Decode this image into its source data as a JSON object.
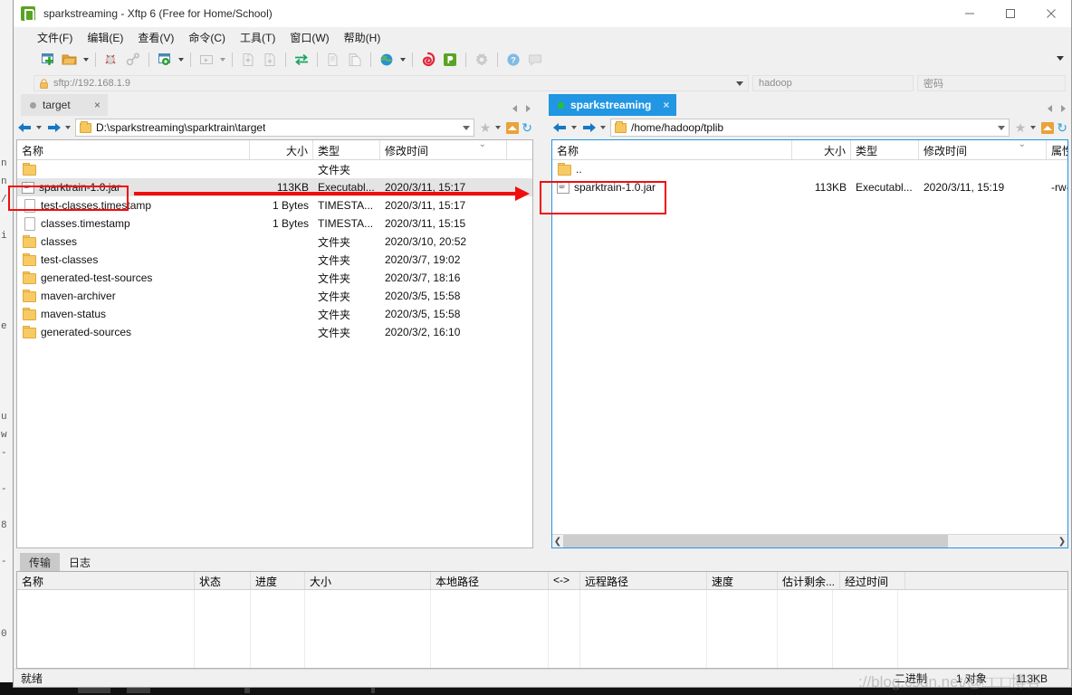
{
  "window": {
    "title": "sparkstreaming - Xftp 6 (Free for Home/School)",
    "app_icon": "xftp-icon",
    "controls": {
      "minimize": "minimize-icon",
      "maximize": "maximize-icon",
      "close": "close-icon"
    }
  },
  "menubar": [
    {
      "label": "文件(F)",
      "name": "menu-file"
    },
    {
      "label": "编辑(E)",
      "name": "menu-edit"
    },
    {
      "label": "查看(V)",
      "name": "menu-view"
    },
    {
      "label": "命令(C)",
      "name": "menu-command"
    },
    {
      "label": "工具(T)",
      "name": "menu-tools"
    },
    {
      "label": "窗口(W)",
      "name": "menu-window"
    },
    {
      "label": "帮助(H)",
      "name": "menu-help"
    }
  ],
  "connection": {
    "host": "sftp://192.168.1.9",
    "lock_icon": "lock-icon",
    "user_value": "hadoop",
    "password_placeholder": "密码"
  },
  "left_pane": {
    "tab": {
      "label": "target",
      "status_dot": "grey",
      "close": "×"
    },
    "path": "D:\\sparkstreaming\\sparktrain\\target",
    "columns": [
      "名称",
      "大小",
      "类型",
      "修改时间"
    ],
    "sort_column": "修改时间",
    "sort_direction": "desc",
    "rows": [
      {
        "icon": "folder",
        "name": "",
        "size": "",
        "type": "文件夹",
        "modified": "",
        "selected": false
      },
      {
        "icon": "jar",
        "name": "sparktrain-1.0.jar",
        "size": "113KB",
        "type": "Executabl...",
        "modified": "2020/3/11, 15:17",
        "selected": true
      },
      {
        "icon": "file",
        "name": "test-classes.timestamp",
        "size": "1 Bytes",
        "type": "TIMESTA...",
        "modified": "2020/3/11, 15:17",
        "selected": false
      },
      {
        "icon": "file",
        "name": "classes.timestamp",
        "size": "1 Bytes",
        "type": "TIMESTA...",
        "modified": "2020/3/11, 15:15",
        "selected": false
      },
      {
        "icon": "folder",
        "name": "classes",
        "size": "",
        "type": "文件夹",
        "modified": "2020/3/10, 20:52",
        "selected": false
      },
      {
        "icon": "folder",
        "name": "test-classes",
        "size": "",
        "type": "文件夹",
        "modified": "2020/3/7, 19:02",
        "selected": false
      },
      {
        "icon": "folder",
        "name": "generated-test-sources",
        "size": "",
        "type": "文件夹",
        "modified": "2020/3/7, 18:16",
        "selected": false
      },
      {
        "icon": "folder",
        "name": "maven-archiver",
        "size": "",
        "type": "文件夹",
        "modified": "2020/3/5, 15:58",
        "selected": false
      },
      {
        "icon": "folder",
        "name": "maven-status",
        "size": "",
        "type": "文件夹",
        "modified": "2020/3/5, 15:58",
        "selected": false
      },
      {
        "icon": "folder",
        "name": "generated-sources",
        "size": "",
        "type": "文件夹",
        "modified": "2020/3/2, 16:10",
        "selected": false
      }
    ]
  },
  "right_pane": {
    "tab": {
      "label": "sparkstreaming",
      "status_dot": "green",
      "close": "×"
    },
    "path": "/home/hadoop/tplib",
    "columns": [
      "名称",
      "大小",
      "类型",
      "修改时间",
      "属性"
    ],
    "sort_column": "修改时间",
    "sort_direction": "desc",
    "rows": [
      {
        "icon": "folder",
        "name": "..",
        "size": "",
        "type": "",
        "modified": "",
        "attrs": ""
      },
      {
        "icon": "jar",
        "name": "sparktrain-1.0.jar",
        "size": "113KB",
        "type": "Executabl...",
        "modified": "2020/3/11, 15:19",
        "attrs": "-rw-"
      }
    ]
  },
  "bottom_panel": {
    "tabs": [
      {
        "label": "传输",
        "active": true,
        "name": "tab-transfer"
      },
      {
        "label": "日志",
        "active": false,
        "name": "tab-log"
      }
    ],
    "columns": [
      "名称",
      "状态",
      "进度",
      "大小",
      "本地路径",
      "<->",
      "远程路径",
      "速度",
      "估计剩余...",
      "经过时间"
    ],
    "rows": []
  },
  "statusbar": {
    "state": "就绪",
    "mode": "二进制",
    "objects": "1 对象",
    "size": "113KB"
  },
  "toolbar": {
    "items": [
      {
        "name": "new-session-icon",
        "label": "新建会话"
      },
      {
        "name": "open-folder-icon",
        "label": "打开"
      },
      {
        "name": "disconnect-icon",
        "label": "断开"
      },
      {
        "name": "link-icon",
        "label": "链接"
      },
      {
        "name": "properties-icon",
        "label": "属性"
      },
      {
        "name": "run-icon",
        "label": "运行"
      },
      {
        "name": "upload-icon",
        "label": "上传"
      },
      {
        "name": "download-icon",
        "label": "下载"
      },
      {
        "name": "sync-icon",
        "label": "同步浏览"
      },
      {
        "name": "copy-icon",
        "label": "复制"
      },
      {
        "name": "paste-icon",
        "label": "粘贴"
      },
      {
        "name": "globe-icon",
        "label": "浏览器"
      },
      {
        "name": "xshell-icon",
        "label": "Xshell"
      },
      {
        "name": "xftp-icon",
        "label": "Xftp"
      },
      {
        "name": "gear-icon",
        "label": "选项"
      },
      {
        "name": "help-icon",
        "label": "帮助"
      },
      {
        "name": "feedback-icon",
        "label": "反馈"
      }
    ]
  },
  "annotations": {
    "left_highlight": "sparktrain-1.0.jar",
    "right_highlight": "sparktrain-1.0.jar",
    "arrow": "upload-direction-arrow"
  },
  "background_text": {
    "gutter_marks": [
      "n",
      "n",
      "/",
      "i",
      "e",
      "u",
      "w",
      "8",
      "0"
    ]
  },
  "watermark": "://blog.csdn.net/@□□□博客",
  "colors": {
    "accent": "#2196e3",
    "annotation": "#f10d0d",
    "folder": "#f7cb64",
    "titlebar": "#ffffff",
    "chrome": "#f0f0f0"
  }
}
